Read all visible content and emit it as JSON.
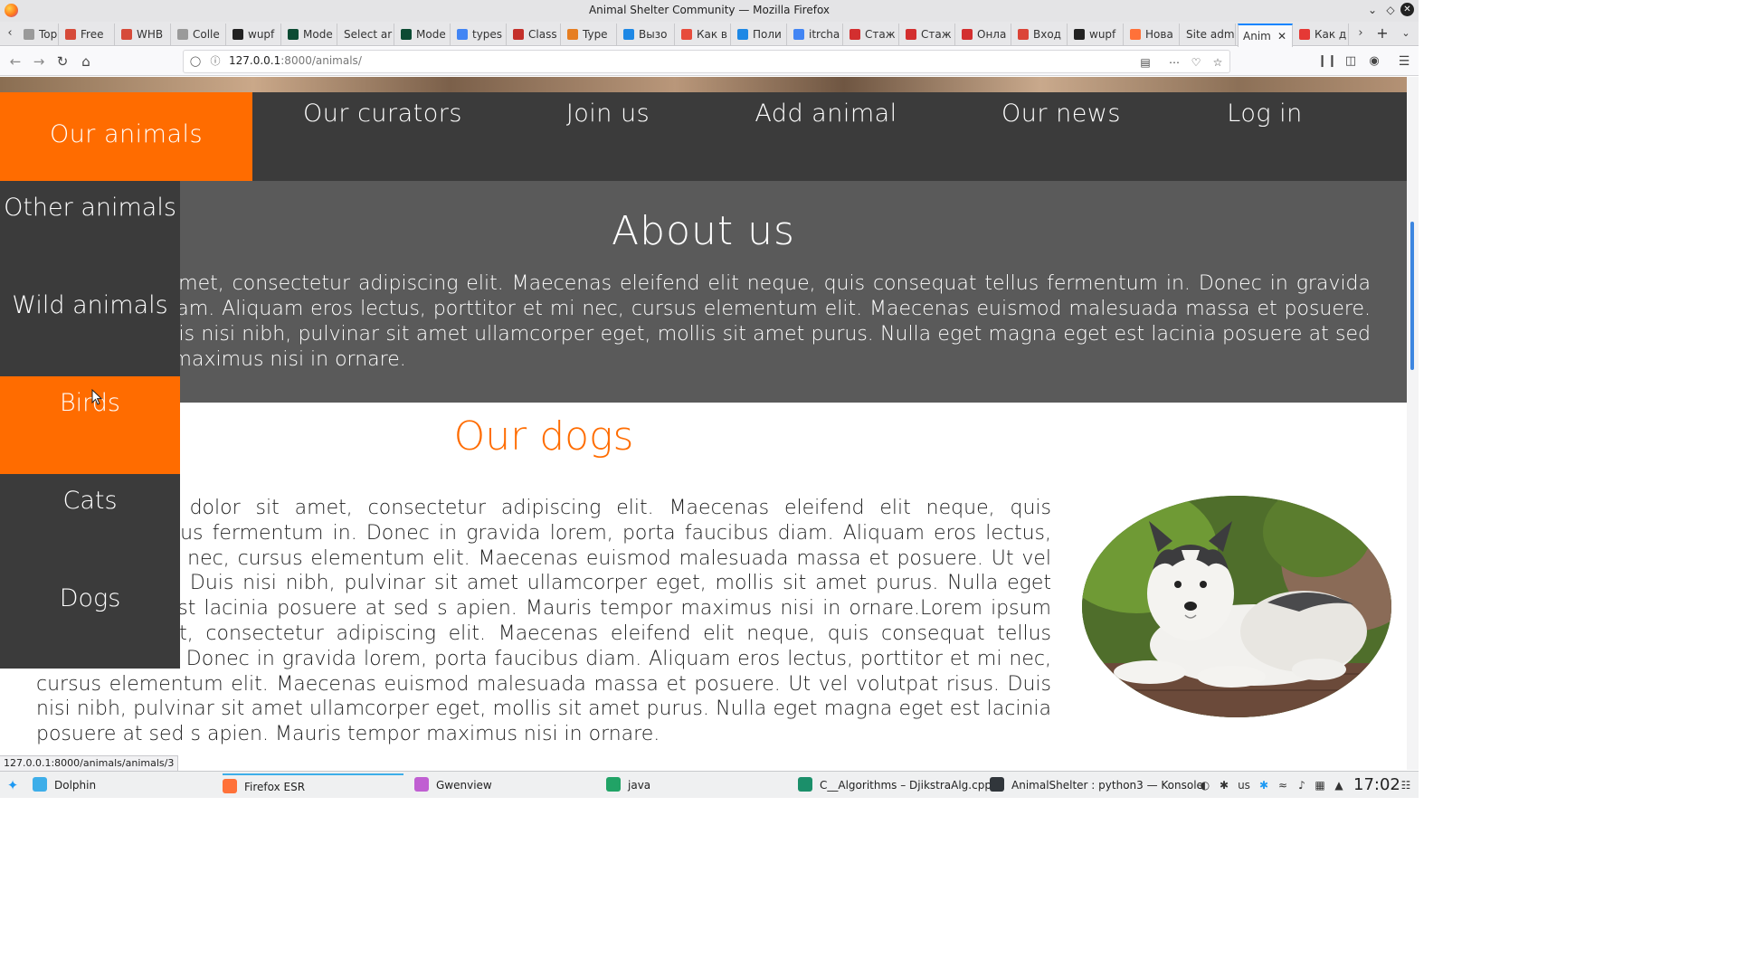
{
  "window": {
    "title": "Animal Shelter Community — Mozilla Firefox"
  },
  "tabs": [
    {
      "label": "Top a",
      "color": "#9a9a9a"
    },
    {
      "label": "Free",
      "color": "#d64b3a"
    },
    {
      "label": "WHB",
      "color": "#d64b3a"
    },
    {
      "label": "Colle",
      "color": "#9a9a9a"
    },
    {
      "label": "wupf",
      "color": "#222222"
    },
    {
      "label": "Mode",
      "color": "#0c4b33"
    },
    {
      "label": "Select ar",
      "color": ""
    },
    {
      "label": "Mode",
      "color": "#0c4b33"
    },
    {
      "label": "types",
      "color": "#4285f4"
    },
    {
      "label": "Class",
      "color": "#c4302b"
    },
    {
      "label": "Type",
      "color": "#e67e22"
    },
    {
      "label": "Вызо",
      "color": "#1e88e5"
    },
    {
      "label": "Как в",
      "color": "#e74c3c"
    },
    {
      "label": "Поли",
      "color": "#1e88e5"
    },
    {
      "label": "itrcha",
      "color": "#4285f4"
    },
    {
      "label": "Стаж",
      "color": "#d32f2f"
    },
    {
      "label": "Стаж",
      "color": "#d32f2f"
    },
    {
      "label": "Онла",
      "color": "#d32f2f"
    },
    {
      "label": "Вход",
      "color": "#db4437"
    },
    {
      "label": "wupf",
      "color": "#222222"
    },
    {
      "label": "Нова",
      "color": "#ff7139"
    },
    {
      "label": "Site adm",
      "color": ""
    },
    {
      "label": "Anim",
      "color": "",
      "active": true
    },
    {
      "label": "Как д",
      "color": "#e53935"
    }
  ],
  "url": {
    "host": "127.0.0.1",
    "rest": ":8000/animals/"
  },
  "nav": {
    "items": [
      "Our animals",
      "Our curators",
      "Join us",
      "Add animal",
      "Our news",
      "Log in"
    ],
    "active_index": 0
  },
  "dropdown": {
    "items": [
      "Other animals",
      "Wild animals",
      "Birds",
      "Cats",
      "Dogs"
    ],
    "hover_index": 2
  },
  "about": {
    "title": "About us",
    "text": "Lorem ipsum dolor sit amet, consectetur adipiscing elit. Maecenas eleifend elit neque, quis consequat tellus fermentum in. Donec in gravida lorem, porta faucibus diam. Aliquam eros lectus, porttitor et mi nec, cursus elementum elit. Maecenas euismod malesuada massa et posuere. Ut vel volutpat risus. Duis nisi nibh, pulvinar sit amet ullamcorper eget, mollis sit amet purus. Nulla eget magna eget est lacinia posuere at sed s apien. Mauris tempor maximus nisi in ornare."
  },
  "dogs": {
    "title": "Our dogs",
    "text": "Lorem ipsum dolor sit amet, consectetur adipiscing elit. Maecenas eleifend elit neque, quis consequat tellus fermentum in. Donec in gravida lorem, porta faucibus diam. Aliquam eros lectus, porttitor et mi nec, cursus elementum elit. Maecenas euismod malesuada massa et posuere. Ut vel volutpat risus. Duis nisi nibh, pulvinar sit amet ullamcorper eget, mollis sit amet purus. Nulla eget magna eget est lacinia posuere at sed s apien. Mauris tempor maximus nisi in ornare.Lorem ipsum dolor sit amet, consectetur adipiscing elit. Maecenas eleifend elit neque, quis consequat tellus fermentum in. Donec in gravida lorem, porta faucibus diam. Aliquam eros lectus, porttitor et mi nec, cursus elementum elit. Maecenas euismod malesuada massa et posuere. Ut vel volutpat risus. Duis nisi nibh, pulvinar sit amet ullamcorper eget, mollis sit amet purus. Nulla eget magna eget est lacinia posuere at sed s apien. Mauris tempor maximus nisi in ornare."
  },
  "status_url": "127.0.0.1:8000/animals/animals/3",
  "taskbar": {
    "tasks": [
      {
        "label": "Dolphin",
        "color": "#3daee9"
      },
      {
        "label": "Firefox ESR",
        "color": "#ff7139",
        "active": true
      },
      {
        "label": "Gwenview",
        "color": "#c05fd2"
      },
      {
        "label": "java",
        "color": "#21a366"
      },
      {
        "label": "C__Algorithms – DjikstraAlg.cpp",
        "color": "#1b8f6a"
      },
      {
        "label": "AnimalShelter : python3 — Konsole",
        "color": "#31363b"
      }
    ],
    "keyboard_layout": "us",
    "clock": "17:02"
  },
  "colors": {
    "accent": "#ff6c00",
    "nav_bg": "#3b3b3b",
    "about_bg": "#5a5a5a"
  }
}
